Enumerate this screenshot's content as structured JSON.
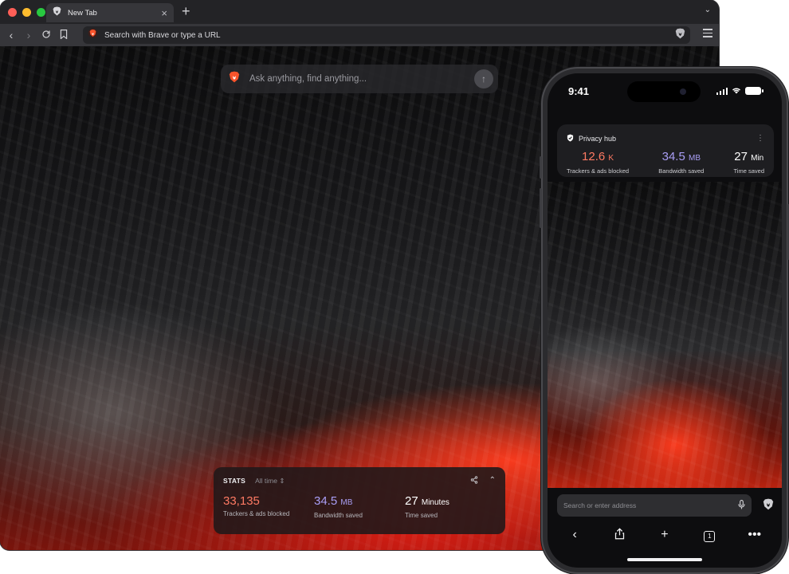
{
  "browser": {
    "tab": {
      "title": "New Tab"
    },
    "toolbar": {
      "url_placeholder": "Search with Brave or type a URL"
    },
    "ask": {
      "placeholder": "Ask anything, find anything..."
    },
    "stats": {
      "label": "STATS",
      "range": "All time",
      "items": [
        {
          "value": "33,135",
          "unit": "",
          "caption": "Trackers & ads blocked",
          "color": "#ff7a63"
        },
        {
          "value": "34.5",
          "unit": "MB",
          "caption": "Bandwidth saved",
          "color": "#a99ef5"
        },
        {
          "value": "27",
          "unit": "Minutes",
          "caption": "Time saved",
          "color": "#ffffff"
        }
      ]
    }
  },
  "phone": {
    "time": "9:41",
    "hub": {
      "title": "Privacy hub",
      "items": [
        {
          "value": "12.6",
          "unit": "K",
          "caption": "Trackers & ads blocked",
          "color": "#ff7a63"
        },
        {
          "value": "34.5",
          "unit": "MB",
          "caption": "Bandwidth saved",
          "color": "#a99ef5"
        },
        {
          "value": "27",
          "unit": "Min",
          "caption": "Time saved",
          "color": "#ffffff"
        }
      ]
    },
    "address": {
      "placeholder": "Search or enter address"
    },
    "tab_count": "1"
  },
  "colors": {
    "brand_orange": "#fb542b",
    "close": "#ff5f57",
    "minimize": "#febc2e",
    "maximize": "#28c840"
  }
}
